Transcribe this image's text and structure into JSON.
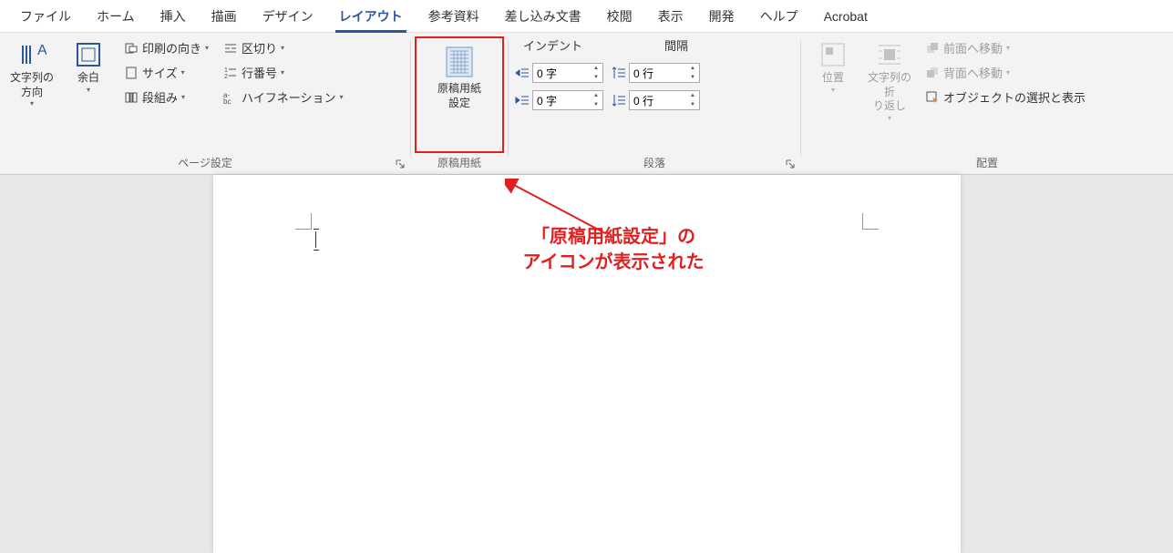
{
  "tabs": [
    "ファイル",
    "ホーム",
    "挿入",
    "描画",
    "デザイン",
    "レイアウト",
    "参考資料",
    "差し込み文書",
    "校閲",
    "表示",
    "開発",
    "ヘルプ",
    "Acrobat"
  ],
  "active_tab_index": 5,
  "page_setup": {
    "text_direction": "文字列の\n方向",
    "margins": "余白",
    "orientation": "印刷の向き",
    "size": "サイズ",
    "columns": "段組み",
    "breaks": "区切り",
    "line_numbers": "行番号",
    "hyphenation": "ハイフネーション",
    "group_label": "ページ設定"
  },
  "manuscript": {
    "button_l1": "原稿用紙",
    "button_l2": "設定",
    "group_label": "原稿用紙"
  },
  "paragraph": {
    "indent_label": "インデント",
    "spacing_label": "間隔",
    "indent_left": "0 字",
    "indent_right": "0 字",
    "spacing_before": "0 行",
    "spacing_after": "0 行",
    "group_label": "段落"
  },
  "arrange": {
    "position": "位置",
    "wrap": "文字列の折\nり返し",
    "bring_forward": "前面へ移動",
    "send_backward": "背面へ移動",
    "selection_pane": "オブジェクトの選択と表示",
    "group_label": "配置"
  },
  "annotation": {
    "line1": "「原稿用紙設定」の",
    "line2": "アイコンが表示された"
  }
}
